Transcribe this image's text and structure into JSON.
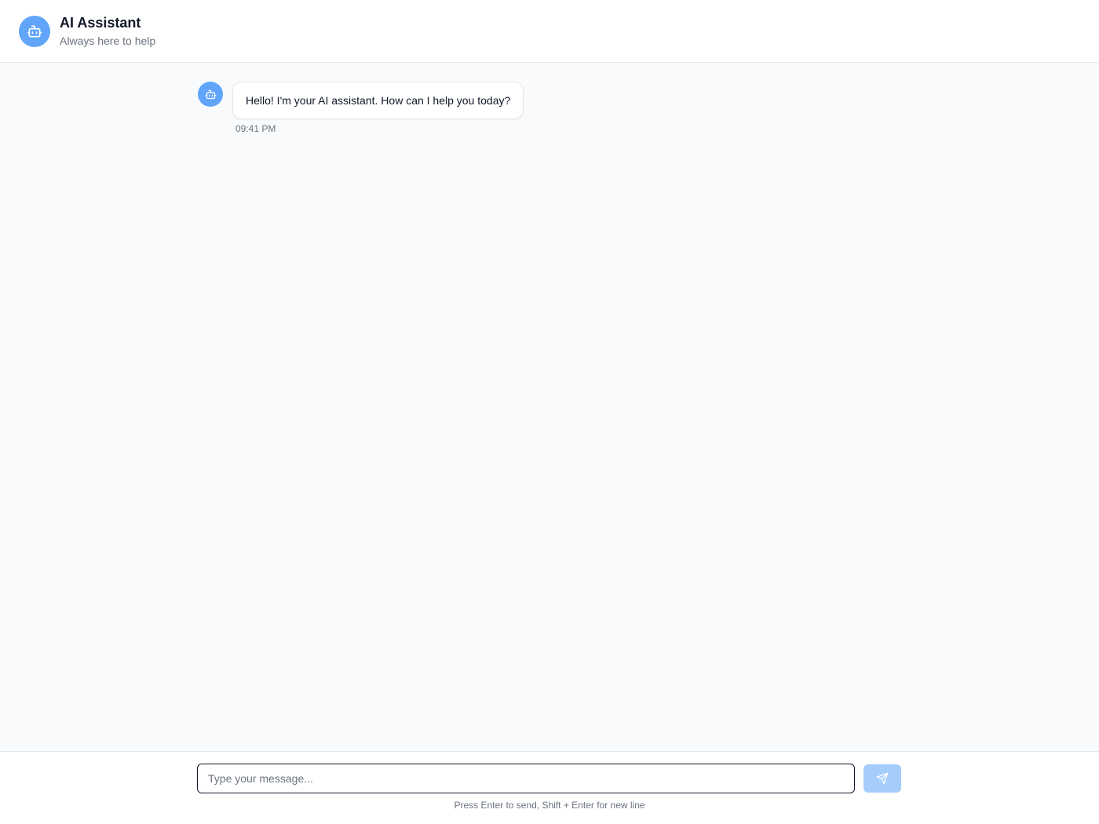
{
  "header": {
    "title": "AI Assistant",
    "subtitle": "Always here to help",
    "avatar_icon": "bot-icon"
  },
  "messages": [
    {
      "sender": "assistant",
      "avatar_icon": "bot-icon",
      "text": "Hello! I'm your AI assistant. How can I help you today?",
      "time": "09:41 PM"
    }
  ],
  "composer": {
    "value": "",
    "placeholder": "Type your message...",
    "send_icon": "send-icon",
    "hint": "Press Enter to send, Shift + Enter for new line"
  },
  "colors": {
    "accent": "#60a5fa",
    "send_disabled": "#a5cdfb",
    "background": "#f8fafc"
  }
}
